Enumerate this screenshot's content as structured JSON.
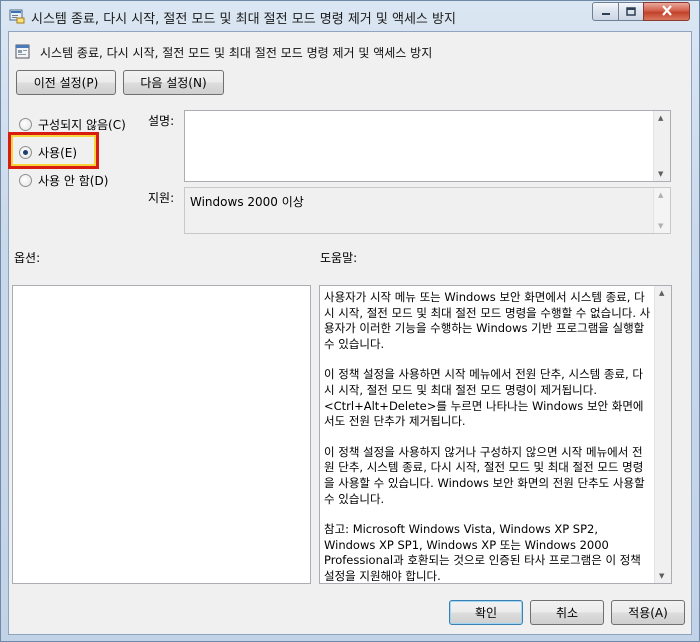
{
  "window": {
    "title": "시스템 종료, 다시 시작, 절전 모드 및 최대 절전 모드 명령 제거 및 액세스 방지",
    "icons": {
      "app": "policy-editor-icon",
      "minimize": "minimize-icon",
      "maximize": "maximize-icon",
      "close": "close-icon"
    }
  },
  "header": {
    "policy_name": "시스템 종료, 다시 시작, 절전 모드 및 최대 절전 모드 명령 제거 및 액세스 방지",
    "icon": "policy-setting-icon"
  },
  "nav": {
    "prev_label": "이전 설정(P)",
    "next_label": "다음 설정(N)"
  },
  "state": {
    "options": [
      {
        "label": "구성되지 않음(C)",
        "checked": false
      },
      {
        "label": "사용(E)",
        "checked": true
      },
      {
        "label": "사용 안 함(D)",
        "checked": false
      }
    ]
  },
  "comment": {
    "label": "설명:",
    "value": ""
  },
  "supported": {
    "label": "지원:",
    "value": "Windows 2000 이상"
  },
  "options_panel": {
    "label": "옵션:"
  },
  "help": {
    "label": "도움말:",
    "paragraphs": [
      "사용자가 시작 메뉴 또는 Windows 보안 화면에서 시스템 종료, 다시 시작, 절전 모드 및 최대 절전 모드 명령을 수행할 수 없습니다. 사용자가 이러한 기능을 수행하는 Windows 기반 프로그램을 실행할 수 있습니다.",
      "이 정책 설정을 사용하면 시작 메뉴에서 전원 단추, 시스템 종료, 다시 시작, 절전 모드 및 최대 절전 모드 명령이 제거됩니다. <Ctrl+Alt+Delete>를 누르면 나타나는 Windows 보안 화면에서도 전원 단추가 제거됩니다.",
      "이 정책 설정을 사용하지 않거나 구성하지 않으면 시작 메뉴에서 전원 단추, 시스템 종료, 다시 시작, 절전 모드 및 최대 절전 모드 명령을 사용할 수 있습니다. Windows 보안 화면의 전원 단추도 사용할 수 있습니다.",
      "참고: Microsoft Windows Vista, Windows XP SP2, Windows XP SP1, Windows XP 또는 Windows 2000 Professional과 호환되는 것으로 인증된 타사 프로그램은 이 정책 설정을 지원해야 합니다."
    ]
  },
  "footer": {
    "ok_label": "확인",
    "cancel_label": "취소",
    "apply_label": "적용(A)"
  },
  "colors": {
    "highlight_border": "#d81c12",
    "highlight_inner": "#f6d339"
  }
}
